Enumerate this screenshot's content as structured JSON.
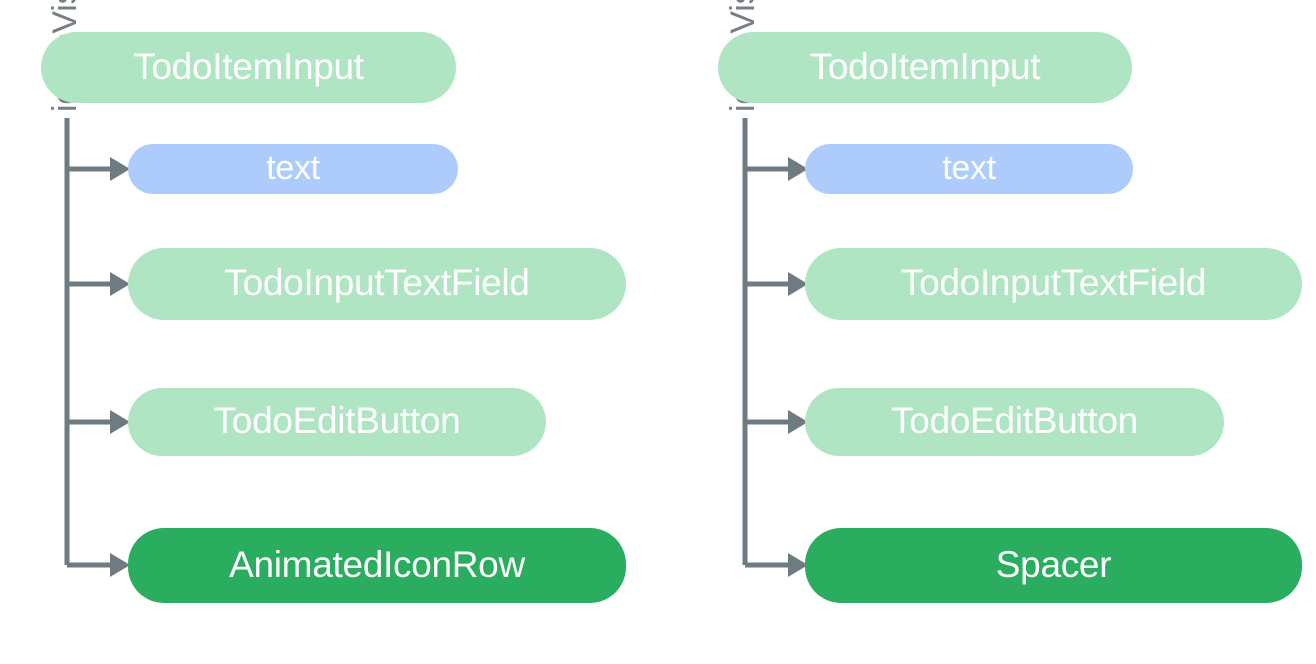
{
  "diagram": {
    "type": "composition-tree",
    "background_color": "#ffffff",
    "colors": {
      "root_fill": "#b0e5c3",
      "param_fill": "#aeccfb",
      "child_fill": "#b0e5c3",
      "highlight_fill": "#2bad5f",
      "node_text": "#ffffff",
      "connector": "#6e7b80",
      "condition_label_text": "#757f84"
    },
    "columns": [
      {
        "id": "left",
        "condition_label": "iconsVisible = false",
        "root": {
          "label": "TodoItemInput",
          "style": "root"
        },
        "children": [
          {
            "label": "text",
            "style": "param"
          },
          {
            "label": "TodoInputTextField",
            "style": "child-green"
          },
          {
            "label": "TodoEditButton",
            "style": "child-green"
          },
          {
            "label": "AnimatedIconRow",
            "style": "highlight"
          }
        ]
      },
      {
        "id": "right",
        "condition_label": "iconsVisible = true",
        "root": {
          "label": "TodoItemInput",
          "style": "root"
        },
        "children": [
          {
            "label": "text",
            "style": "param"
          },
          {
            "label": "TodoInputTextField",
            "style": "child-green"
          },
          {
            "label": "TodoEditButton",
            "style": "child-green"
          },
          {
            "label": "Spacer",
            "style": "highlight"
          }
        ]
      }
    ]
  }
}
